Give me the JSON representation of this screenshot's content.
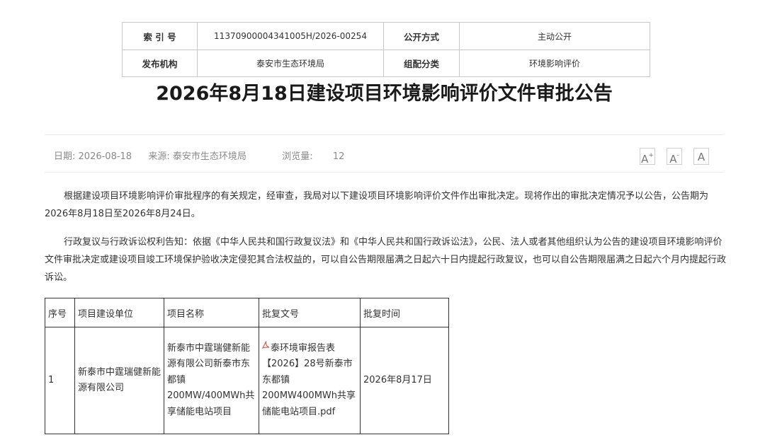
{
  "meta": {
    "index_label": "索 引 号",
    "index_value": "11370900004341005H/2026-00254",
    "disclosure_label": "公开方式",
    "disclosure_value": "主动公开",
    "publisher_label": "发布机构",
    "publisher_value": "泰安市生态环境局",
    "category_label": "组配分类",
    "category_value": "环境影响评价"
  },
  "title": "2026年8月18日建设项目环境影响评价文件审批公告",
  "info": {
    "date_label": "日期:",
    "date_value": "2026-08-18",
    "source_label": "来源:",
    "source_value": "泰安市生态环境局",
    "views_label": "浏览量:",
    "views_value": "12"
  },
  "font_controls": {
    "increase": "A",
    "increase_sup": "+",
    "decrease": "A",
    "decrease_sup": "-",
    "reset": "A"
  },
  "body": {
    "para1": "根据建设项目环境影响评价审批程序的有关规定，经审查，我局对以下建设项目环境影响评价文件作出审批决定。现将作出的审批决定情况予以公告，公告期为2026年8月18日至2026年8月24日。",
    "para2": "行政复议与行政诉讼权利告知：依据《中华人民共和国行政复议法》和《中华人民共和国行政诉讼法》，公民、法人或者其他组织认为公告的建设项目环境影响评价文件审批决定或建设项目竣工环境保护验收决定侵犯其合法权益的，可以自公告期限届满之日起六十日内提起行政复议，也可以自公告期限届满之日起六个月内提起行政诉讼。"
  },
  "projects": {
    "headers": [
      "序号",
      "项目建设单位",
      "项目名称",
      "批复文号",
      "批复时间"
    ],
    "rows": [
      {
        "no": "1",
        "unit": "新泰市中霆瑞健新能源有限公司",
        "name": "新泰市中霆瑞健新能源有限公司新泰市东都镇200MW/400MWh共享储能电站项目",
        "approval_doc": "泰环境审报告表【2026】28号新泰市东都镇200MW400MWh共享储能电站项目.pdf",
        "approval_date": "2026年8月17日"
      }
    ]
  },
  "colors": {
    "pdf_icon": "#e0453a",
    "border": "#c8c8c8",
    "muted_text": "#8a8a8a"
  }
}
